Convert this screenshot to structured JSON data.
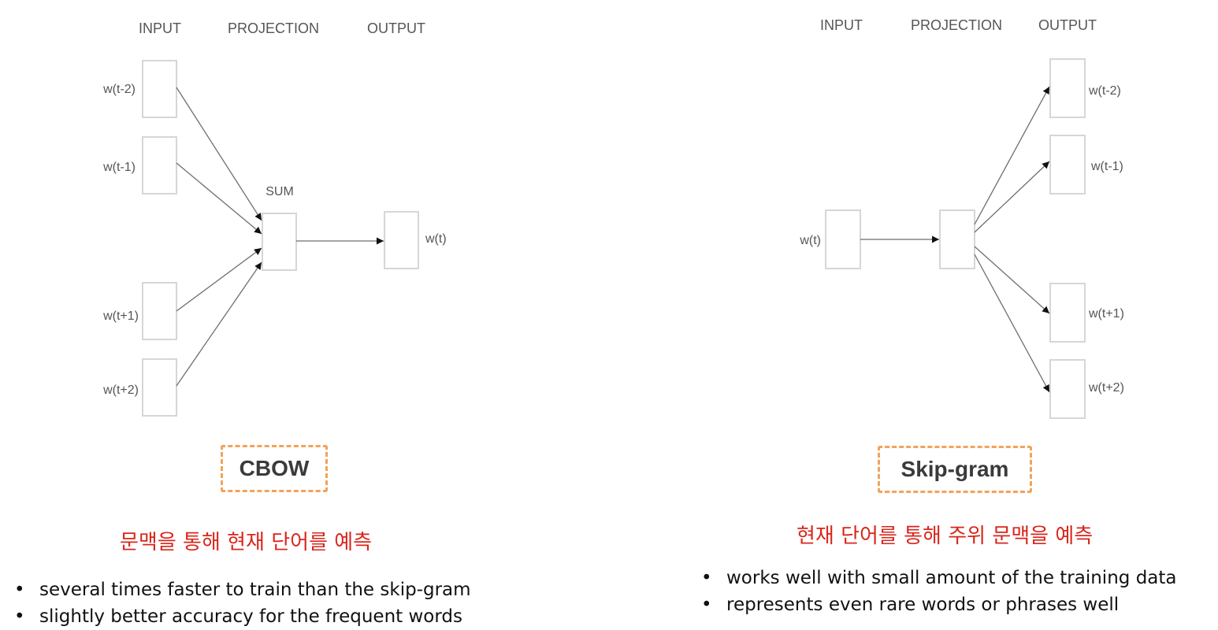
{
  "cbow": {
    "headers": {
      "input": "INPUT",
      "projection": "PROJECTION",
      "output": "OUTPUT"
    },
    "sum_label": "SUM",
    "inputs": [
      "w(t-2)",
      "w(t-1)",
      "w(t+1)",
      "w(t+2)"
    ],
    "output": "w(t)",
    "title": "CBOW",
    "description": "문맥을 통해 현재 단어를 예측",
    "bullets": [
      "several times faster to train than the skip-gram",
      "slightly better accuracy for the frequent words"
    ]
  },
  "skipgram": {
    "headers": {
      "input": "INPUT",
      "projection": "PROJECTION",
      "output": "OUTPUT"
    },
    "input": "w(t)",
    "outputs": [
      "w(t-2)",
      "w(t-1)",
      "w(t+1)",
      "w(t+2)"
    ],
    "title": "Skip-gram",
    "description": "현재 단어를 통해 주위 문맥을 예측",
    "bullets": [
      "works well with small amount of the training data",
      "represents even rare words or phrases well"
    ]
  },
  "colors": {
    "accent_dashed": "#f4a25a",
    "description_red": "#d9261c"
  }
}
